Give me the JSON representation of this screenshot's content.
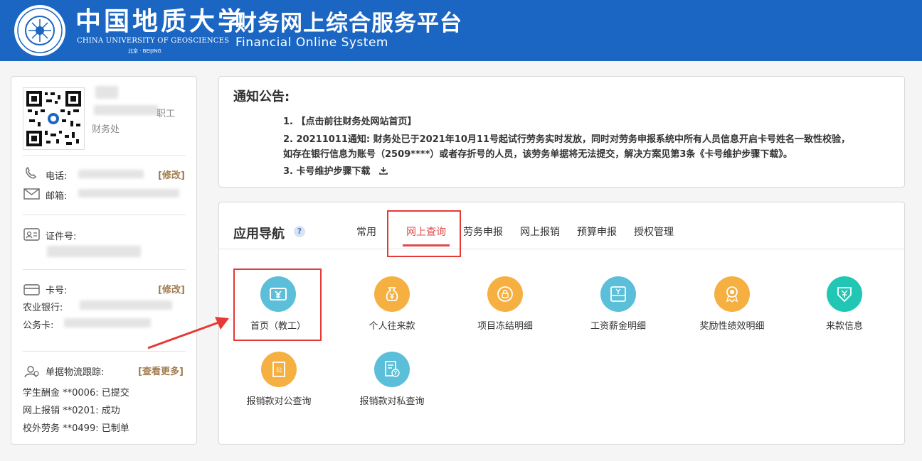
{
  "header": {
    "univ_cn": "中国地质大学",
    "univ_en": "CHINA UNIVERSITY OF GEOSCIENCES",
    "univ_loc": "北京 · BEIJING",
    "sys_cn": "财务网上综合服务平台",
    "sys_en": "Financial Online System",
    "bg_color": "#1a66c2"
  },
  "profile": {
    "role_suffix": "职工",
    "department": "财务处",
    "phone_label": "电话:",
    "phone_edit": "[修改]",
    "email_label": "邮箱:",
    "id_label": "证件号:",
    "card_label": "卡号:",
    "card_edit": "[修改]",
    "bank1": "农业银行:",
    "bank2": "公务卡:",
    "tracking_label": "单据物流跟踪:",
    "tracking_more": "[查看更多]",
    "tracking": [
      "学生酬金 **0006: 已提交",
      "网上报销 **0201: 成功",
      "校外劳务 **0499: 已制单"
    ]
  },
  "notice": {
    "title": "通知公告:",
    "lines": [
      "1. 【点击前往财务处网站首页】",
      "2. 20211011通知: 财务处已于2021年10月11号起试行劳务实时发放，同时对劳务申报系统中所有人员信息开启卡号姓名一致性校验，",
      "如存在银行信息为账号（2509****）或者存折号的人员，该劳务单据将无法提交，解决方案见第3条《卡号维护步骤下载》。",
      "3. 卡号维护步骤下载"
    ]
  },
  "nav": {
    "title": "应用导航",
    "help": "?",
    "tabs": [
      "常用",
      "网上查询",
      "劳务申报",
      "网上报销",
      "预算申报",
      "授权管理"
    ],
    "active_tab": "网上查询",
    "active_color": "#e04b4b",
    "apps": [
      {
        "name": "首页（教工）",
        "color": "#5bbfd9",
        "icon": "ticket-yen-icon"
      },
      {
        "name": "个人往来款",
        "color": "#f5b041",
        "icon": "money-bag-icon"
      },
      {
        "name": "项目冻结明细",
        "color": "#f5b041",
        "icon": "lock-coin-icon"
      },
      {
        "name": "工资薪金明细",
        "color": "#5bbfd9",
        "icon": "wallet-icon"
      },
      {
        "name": "奖励性绩效明细",
        "color": "#f5b041",
        "icon": "award-medal-icon"
      },
      {
        "name": "来款信息",
        "color": "#21c6b4",
        "icon": "incoming-money-icon"
      },
      {
        "name": "报销款对公查询",
        "color": "#f5b041",
        "icon": "public-receipt-icon"
      },
      {
        "name": "报销款对私查询",
        "color": "#5bbfd9",
        "icon": "private-receipt-icon"
      }
    ]
  }
}
